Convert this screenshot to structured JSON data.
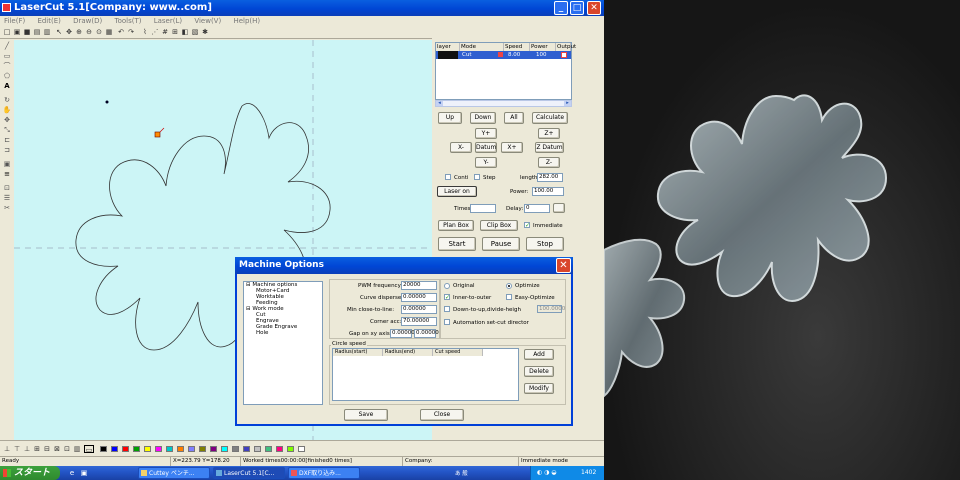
{
  "app": {
    "title": "LaserCut 5.1[Company: www..com]",
    "menu": [
      "File(F)",
      "Edit(E)",
      "Draw(D)",
      "Tools(T)",
      "Laser(L)",
      "View(V)",
      "Help(H)"
    ],
    "window_buttons": {
      "minimize": "_",
      "maximize": "□",
      "close": "✕"
    }
  },
  "layers": {
    "headers": [
      "layer",
      "Mode",
      "Speed",
      "Power",
      "Output"
    ],
    "row": {
      "mode": "Cut",
      "speed": "8.00",
      "power": "100"
    }
  },
  "controls": {
    "up": "Up",
    "down": "Down",
    "all": "All",
    "calculate": "Calculate",
    "y_plus": "Y+",
    "y_minus": "Y-",
    "x_minus": "X-",
    "x_plus": "X+",
    "datum": "Datum",
    "z_plus": "Z+",
    "z_minus": "Z-",
    "z_datum": "Z Datum",
    "cont_label": "Conti",
    "step_label": "Step",
    "length_label": "length:",
    "length_value": "282.00",
    "laser_on": "Laser on",
    "power_label": "Power:",
    "power_value": "100.00",
    "times_label": "Times:",
    "delay_label": "Delay:",
    "delay_value": "0",
    "plan_box": "Plan Box",
    "clip_box": "Clip Box",
    "immediate": "Immediate",
    "start": "Start",
    "pause": "Pause",
    "stop": "Stop"
  },
  "palette": {
    "colors": [
      "#000000",
      "#0000ff",
      "#ff0000",
      "#00a000",
      "#ffff00",
      "#ff00ff",
      "#00c8c8",
      "#ff8000",
      "#8080ff",
      "#808000",
      "#800080",
      "#00ffff",
      "#808080",
      "#4040c0",
      "#c0c0c0",
      "#40c080",
      "#ff0080",
      "#80ff00",
      "#ffffff"
    ]
  },
  "status": {
    "ready": "Ready",
    "coords": "X=223.79 Y=178.20",
    "worked": "Worked times00:00:00[finished0 times]",
    "company": "Company:",
    "mode": "Immediate mode"
  },
  "taskbar": {
    "start": "スタート",
    "tasks": [
      "Cuttey ペンチ...",
      "LaserCut 5.1[C...",
      "DXF取り込み..."
    ],
    "clock": "1402",
    "ime": "あ 般"
  },
  "dialog": {
    "title": "Machine Options",
    "tree": [
      "Machine options",
      "Motor+Card",
      "Worktable",
      "Feeding",
      "Work mode",
      "Cut",
      "Engrave",
      "Grade Engrave",
      "Hole"
    ],
    "fields": [
      {
        "label": "PWM frequency:",
        "value": "20000"
      },
      {
        "label": "Curve disperse:",
        "value": "0.00000"
      },
      {
        "label": "Min close-to-line:",
        "value": "0.00000"
      },
      {
        "label": "Corner acc:",
        "value": "70.00000"
      }
    ],
    "gap_label": "Gap on xy axis:",
    "gap_x": "0.00000",
    "gap_y": "0.00000",
    "options": {
      "original": "Original",
      "optimize": "Optimize",
      "inner_to_outer": "Inner-to-outer",
      "easy_optimize": "Easy-Optimize",
      "down_to_up": "Down-to-up,divide-heigh",
      "divide_value": "100.0000",
      "auto_cut": "Automation set-cut director"
    },
    "circle_speed": "Circle speed",
    "cs_headers": [
      "Radius(start)",
      "Radius(end)",
      "Cut speed"
    ],
    "add": "Add",
    "delete": "Delete",
    "modify": "Modify",
    "save": "Save",
    "close": "Close"
  }
}
